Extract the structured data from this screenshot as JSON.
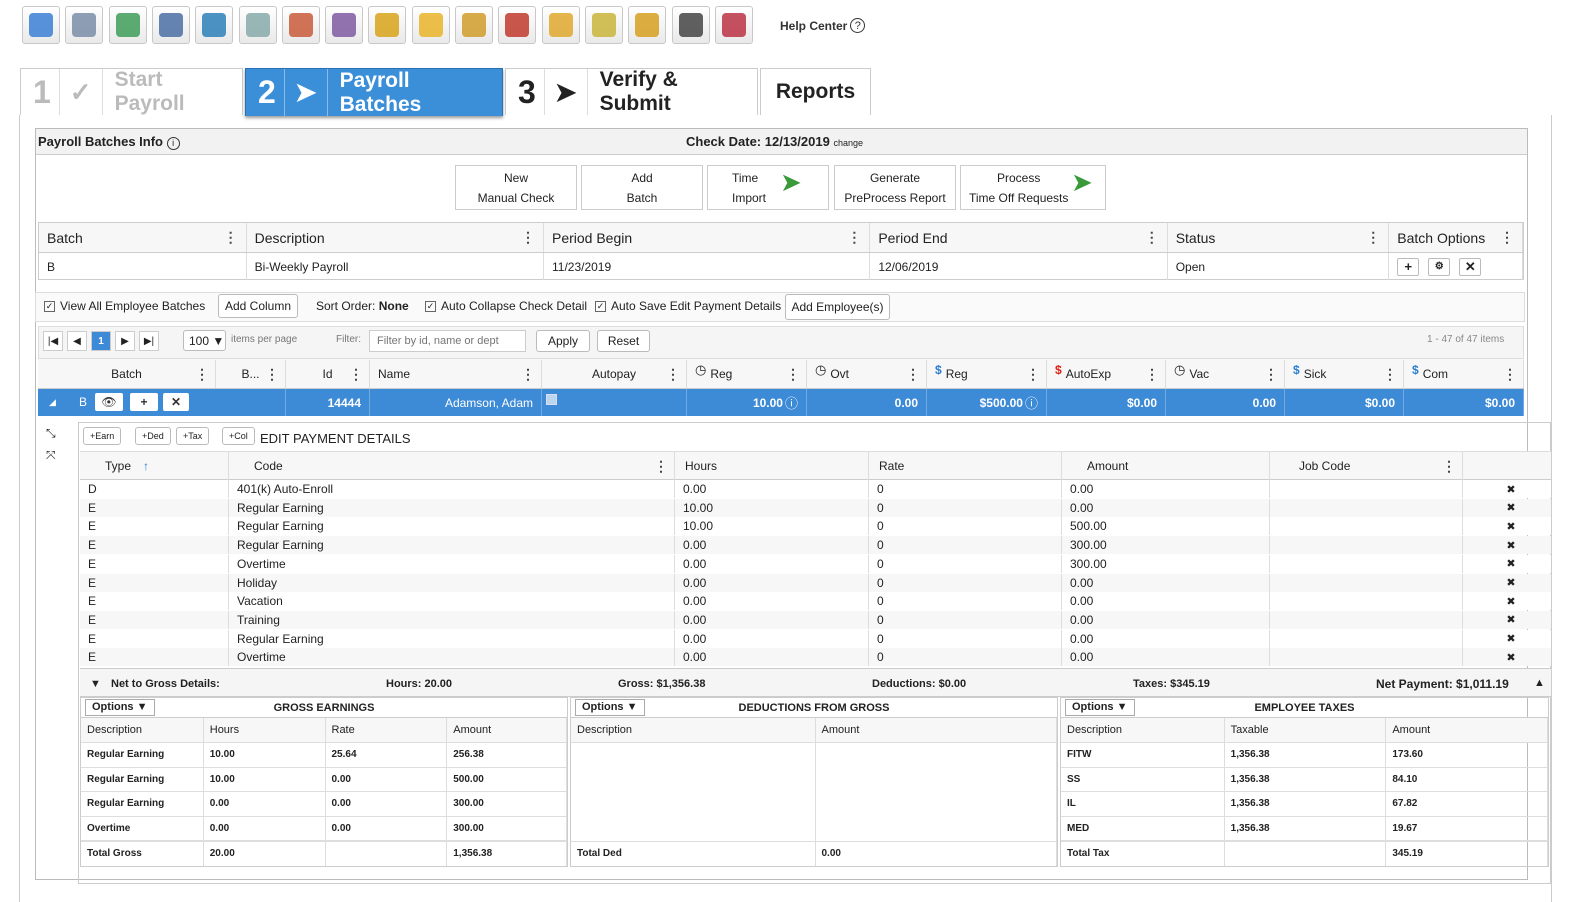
{
  "toolbar": {
    "icons": [
      "home-icon",
      "clock-gear-icon",
      "envelope-icon",
      "people-icon",
      "chat-icon",
      "network-icon",
      "clipboard-icon",
      "user-search-icon",
      "money-people-icon",
      "folder-icon",
      "user-idea-icon",
      "caduceus-icon",
      "folder-open-icon",
      "chart-pencil-icon",
      "presentation-icon",
      "document-add-icon",
      "presentation-chart-icon"
    ],
    "help_label": "Help Center"
  },
  "steps": [
    {
      "num": "1",
      "label": "Start Payroll"
    },
    {
      "num": "2",
      "label": "Payroll Batches"
    },
    {
      "num": "3",
      "label": "Verify & Submit"
    },
    {
      "label": "Reports"
    }
  ],
  "panel": {
    "title": "Payroll Batches Info",
    "check_date_label": "Check Date: 12/13/2019",
    "change": "change"
  },
  "buttons": [
    {
      "l1": "New",
      "l2": "Manual Check"
    },
    {
      "l1": "Add",
      "l2": "Batch"
    },
    {
      "l1": "Time",
      "l2": "Import"
    },
    {
      "l1": "Generate",
      "l2": "PreProcess Report"
    },
    {
      "l1": "Process",
      "l2": "Time Off Requests"
    }
  ],
  "batch_grid": {
    "headers": [
      "Batch",
      "Description",
      "Period Begin",
      "Period End",
      "Status",
      "Batch Options"
    ],
    "row": [
      "B",
      "Bi-Weekly Payroll",
      "11/23/2019",
      "12/06/2019",
      "Open"
    ]
  },
  "opts": {
    "view_all": "View All Employee Batches",
    "add_column": "Add Column",
    "sort_label": "Sort Order:",
    "sort_value": "None",
    "auto_collapse": "Auto Collapse Check Detail",
    "auto_save": "Auto Save Edit Payment Details",
    "add_employee": "Add Employee(s)"
  },
  "pager": {
    "page": "1",
    "per_page": "100",
    "per_page_label": "items per page",
    "filter_label": "Filter:",
    "filter_placeholder": "Filter by id, name or dept",
    "apply": "Apply",
    "reset": "Reset",
    "info": "1 - 47 of 47 items"
  },
  "emp_grid": {
    "headers": [
      "Batch",
      "B...",
      "Id",
      "Name",
      "Autopay",
      "Reg",
      "Ovt",
      "Reg",
      "AutoExp",
      "Vac",
      "Sick",
      "Com"
    ],
    "row": {
      "batch": "B",
      "id": "14444",
      "name": "Adamson, Adam",
      "reg_hours": "10.00",
      "ovt": "0.00",
      "reg_amt": "$500.00",
      "autoexp": "$0.00",
      "vac": "0.00",
      "sick": "$0.00",
      "com": "$0.00"
    }
  },
  "pay_details": {
    "title": "EDIT PAYMENT DETAILS",
    "tools": [
      "+Earn",
      "+Ded",
      "+Tax",
      "+Col"
    ],
    "headers": [
      "Type",
      "Code",
      "Hours",
      "Rate",
      "Amount",
      "Job Code"
    ],
    "rows": [
      [
        "D",
        "401(k) Auto-Enroll",
        "0.00",
        "0",
        "0.00"
      ],
      [
        "E",
        "Regular Earning",
        "10.00",
        "0",
        "0.00"
      ],
      [
        "E",
        "Regular Earning",
        "10.00",
        "0",
        "500.00"
      ],
      [
        "E",
        "Regular Earning",
        "0.00",
        "0",
        "300.00"
      ],
      [
        "E",
        "Overtime",
        "0.00",
        "0",
        "300.00"
      ],
      [
        "E",
        "Holiday",
        "0.00",
        "0",
        "0.00"
      ],
      [
        "E",
        "Vacation",
        "0.00",
        "0",
        "0.00"
      ],
      [
        "E",
        "Training",
        "0.00",
        "0",
        "0.00"
      ],
      [
        "E",
        "Regular Earning",
        "0.00",
        "0",
        "0.00"
      ],
      [
        "E",
        "Overtime",
        "0.00",
        "0",
        "0.00"
      ]
    ]
  },
  "net": {
    "label": "Net to Gross Details:",
    "hours": "Hours: 20.00",
    "gross": "Gross: $1,356.38",
    "deductions": "Deductions: $0.00",
    "taxes": "Taxes: $345.19",
    "net": "Net Payment: $1,011.19"
  },
  "gross": {
    "title": "GROSS EARNINGS",
    "options": "Options",
    "headers": [
      "Description",
      "Hours",
      "Rate",
      "Amount"
    ],
    "rows": [
      [
        "Regular Earning",
        "10.00",
        "25.64",
        "256.38"
      ],
      [
        "Regular Earning",
        "10.00",
        "0.00",
        "500.00"
      ],
      [
        "Regular Earning",
        "0.00",
        "0.00",
        "300.00"
      ],
      [
        "Overtime",
        "0.00",
        "0.00",
        "300.00"
      ]
    ],
    "total": [
      "Total Gross",
      "20.00",
      "",
      "1,356.38"
    ]
  },
  "deductions": {
    "title": "DEDUCTIONS FROM GROSS",
    "options": "Options",
    "headers": [
      "Description",
      "Amount"
    ],
    "total": [
      "Total Ded",
      "0.00"
    ]
  },
  "taxes": {
    "title": "EMPLOYEE TAXES",
    "options": "Options",
    "headers": [
      "Description",
      "Taxable",
      "Amount"
    ],
    "rows": [
      [
        "FITW",
        "1,356.38",
        "173.60"
      ],
      [
        "SS",
        "1,356.38",
        "84.10"
      ],
      [
        "IL",
        "1,356.38",
        "67.82"
      ],
      [
        "MED",
        "1,356.38",
        "19.67"
      ]
    ],
    "total": [
      "Total Tax",
      "",
      "345.19"
    ]
  },
  "colors": {
    "accent": "#3d8ad7",
    "step_active": "#3b8fd9",
    "arrow_green": "#3a9a3a"
  }
}
